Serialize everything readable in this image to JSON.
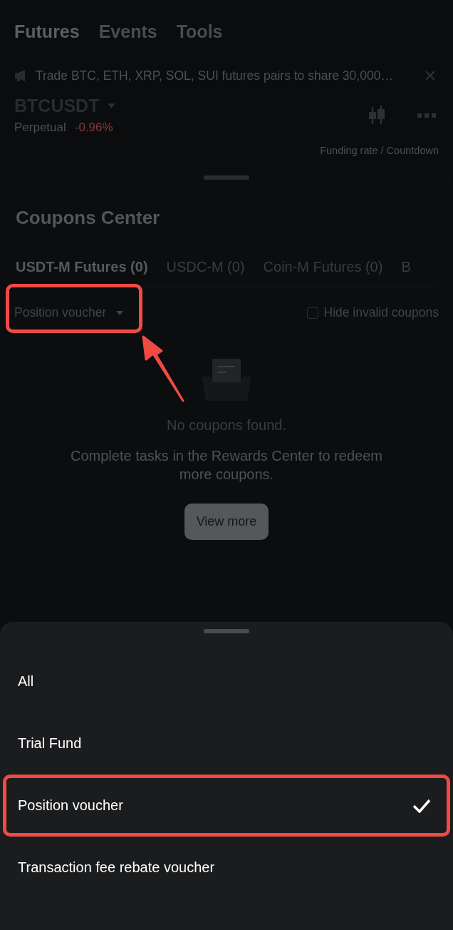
{
  "background": {
    "nav_tabs": [
      {
        "label": "Futures",
        "selected": true
      },
      {
        "label": "Events",
        "selected": false
      },
      {
        "label": "Tools",
        "selected": false
      }
    ],
    "banner": "Trade BTC, ETH, XRP, SOL, SUI futures pairs to share 30,000…",
    "symbol": "BTCUSDT",
    "contract": "Perpetual",
    "change": "-0.96%",
    "funding_label": "Funding rate / Countdown"
  },
  "coupons": {
    "title": "Coupons Center",
    "tabs": [
      {
        "label": "USDT-M Futures (0)",
        "selected": true
      },
      {
        "label": "USDC-M (0)",
        "selected": false
      },
      {
        "label": "Coin-M Futures (0)",
        "selected": false
      },
      {
        "label": "B",
        "selected": false
      }
    ],
    "filter": {
      "label": "Position voucher",
      "highlighted": true
    },
    "hide_invalid": {
      "label": "Hide invalid coupons",
      "checked": false
    },
    "empty_title": "No coupons found.",
    "empty_message": "Complete tasks in the Rewards Center to redeem more coupons.",
    "button": "View more"
  },
  "sheet": {
    "options": [
      {
        "label": "All",
        "selected": false,
        "highlighted": false
      },
      {
        "label": "Trial Fund",
        "selected": false,
        "highlighted": false
      },
      {
        "label": "Position voucher",
        "selected": true,
        "highlighted": true
      },
      {
        "label": "Transaction fee rebate voucher",
        "selected": false,
        "highlighted": false
      }
    ]
  }
}
